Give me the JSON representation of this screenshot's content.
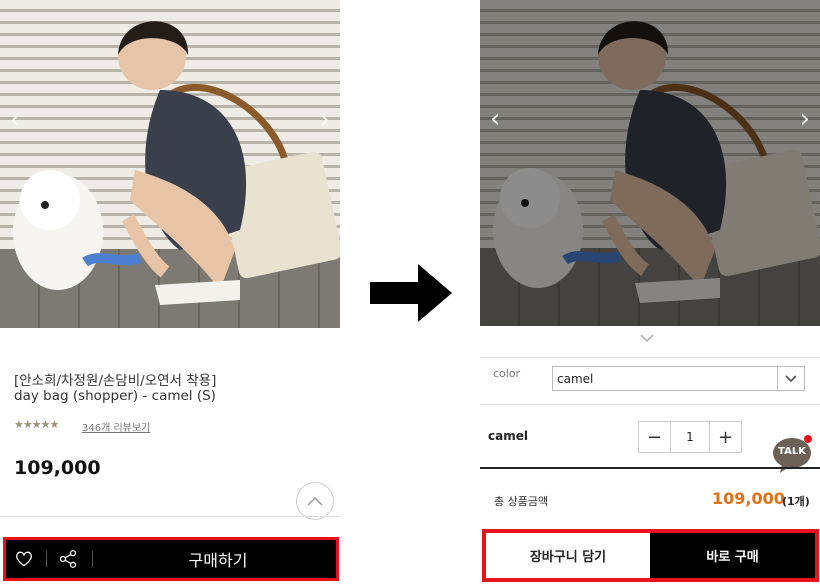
{
  "left": {
    "nav_prev": "‹",
    "nav_next": "›",
    "title_line1": "[안소희/차정원/손담비/오연서 착용]",
    "title_line2": "day bag (shopper) - camel (S)",
    "stars": "★★★★★",
    "review_link": "346개 리뷰보기",
    "price": "109,000",
    "buy_label": "구매하기",
    "icons": [
      "heart-icon",
      "share-icon",
      "chevron-up-icon"
    ]
  },
  "right": {
    "nav_prev": "‹",
    "nav_next": "›",
    "color_label": "color",
    "color_value": "camel",
    "option_name": "camel",
    "quantity": "1",
    "minus": "−",
    "plus": "+",
    "talk_label": "TALK",
    "total_label": "총 상품금액",
    "total_price": "109,000",
    "total_qty": "(1개)",
    "cart_label": "장바구니 담기",
    "buy_now_label": "바로 구매"
  },
  "colors": {
    "highlight": "#e8121a",
    "price_accent": "#e07011",
    "bar_black": "#000000"
  }
}
